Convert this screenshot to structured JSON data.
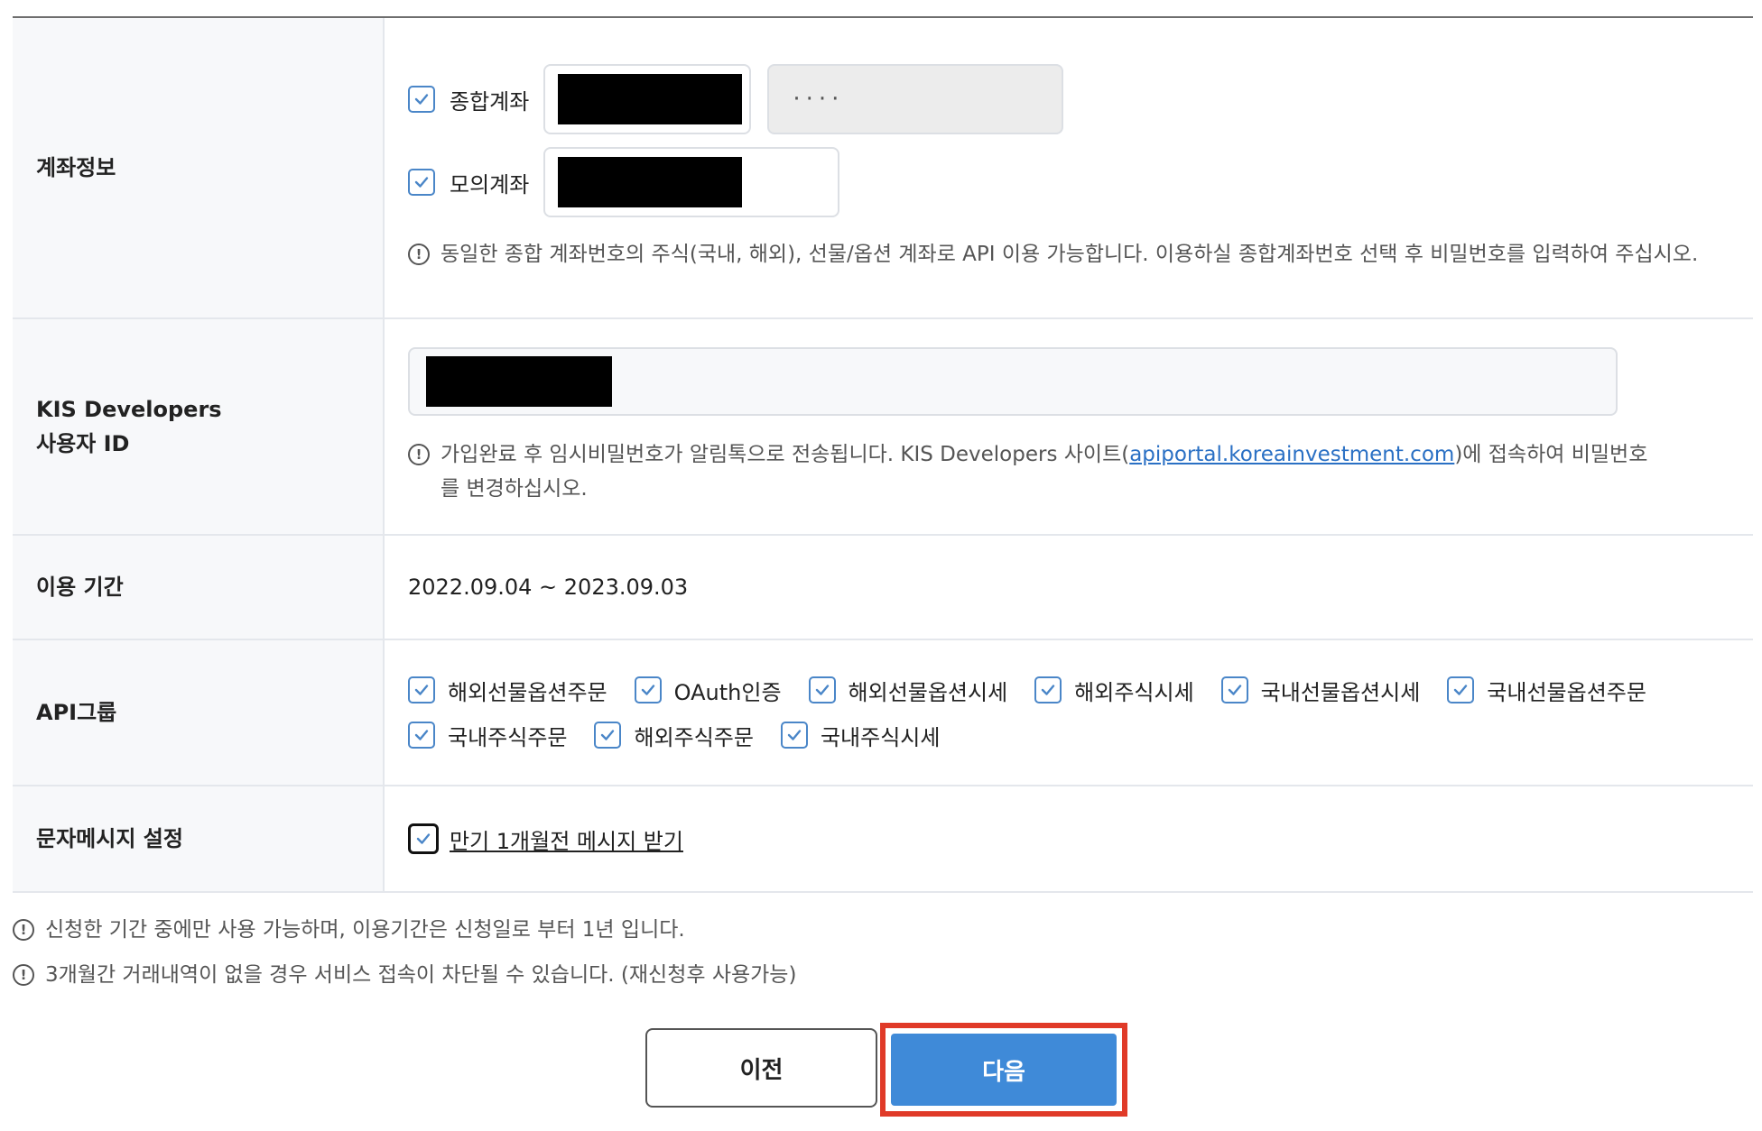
{
  "account_info": {
    "label": "계좌정보",
    "general_account_label": "종합계좌",
    "general_account_password_mask": "····",
    "mock_account_label": "모의계좌",
    "notice": "동일한 종합 계좌번호의 주식(국내, 해외), 선물/옵션 계좌로 API 이용 가능합니다. 이용하실 종합계좌번호 선택 후 비밀번호를 입력하여 주십시오."
  },
  "user_id": {
    "label_line1": "KIS Developers",
    "label_line2": "사용자 ID",
    "notice_prefix": "가입완료 후 임시비밀번호가 알림톡으로 전송됩니다. KIS Developers 사이트(",
    "notice_link": "apiportal.koreainvestment.com",
    "notice_suffix": ")에 접속하여 비밀번호를 변경하십시오."
  },
  "period": {
    "label": "이용 기간",
    "value": "2022.09.04 ~ 2023.09.03"
  },
  "api_group": {
    "label": "API그룹",
    "items": [
      "해외선물옵션주문",
      "OAuth인증",
      "해외선물옵션시세",
      "해외주식시세",
      "국내선물옵션시세",
      "국내선물옵션주문",
      "국내주식주문",
      "해외주식주문",
      "국내주식시세"
    ]
  },
  "sms": {
    "label": "문자메시지 설정",
    "option": "만기 1개월전 메시지 받기"
  },
  "bottom_notices": [
    "신청한 기간 중에만 사용 가능하며, 이용기간은 신청일로 부터 1년 입니다.",
    "3개월간 거래내역이 없을 경우 서비스 접속이 차단될 수 있습니다. (재신청후 사용가능)"
  ],
  "buttons": {
    "prev": "이전",
    "next": "다음"
  },
  "colors": {
    "checkbox_border": "#4a86c8",
    "next_button": "#3f8ad8",
    "highlight_border": "#e03a28",
    "link": "#2a70c4"
  }
}
